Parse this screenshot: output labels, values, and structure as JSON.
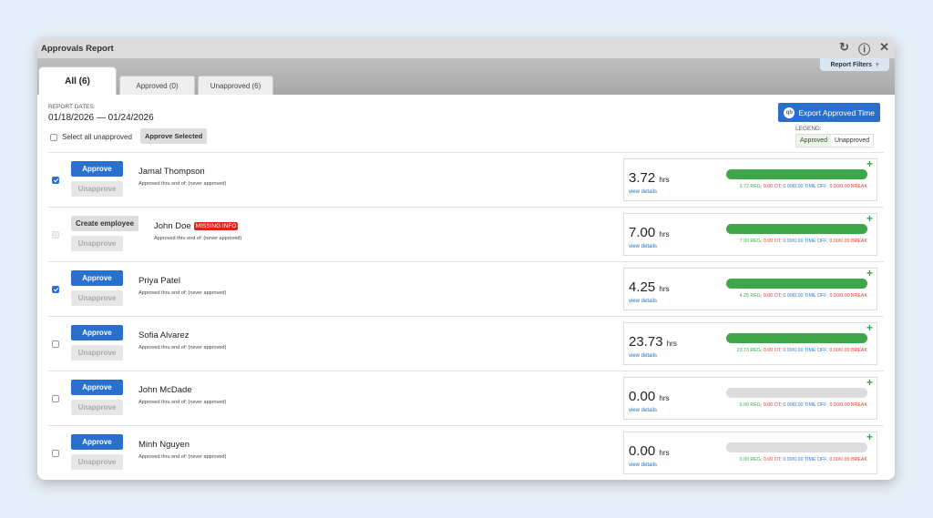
{
  "window": {
    "title": "Approvals Report",
    "icons": [
      "refresh-icon",
      "help-icon",
      "close-icon"
    ]
  },
  "tabs": [
    {
      "label": "All (6)",
      "active": true
    },
    {
      "label": "Approved (0)"
    },
    {
      "label": "Unapproved (6)"
    }
  ],
  "report_filters": "Report Filters",
  "report_dates_label": "REPORT DATES:",
  "report_dates": "01/18/2026 — 01/24/2026",
  "select_all_label": "Select all unapproved",
  "approve_selected": "Approve Selected",
  "export": {
    "icon_text": "qb",
    "label": "Export Approved Time"
  },
  "legend": {
    "label": "LEGEND:",
    "approved": "Approved",
    "unapproved": "Unapproved"
  },
  "colors": {
    "accent": "#2a6fc9",
    "approved": "#3fa64a",
    "missing": "#d9251c"
  },
  "rows": [
    {
      "name": "Jamal Thompson",
      "checked": true,
      "action": "Approve",
      "unapprove": "Unapprove",
      "thru": "Approved thru end of: (never approved)",
      "hours": "3.72",
      "unit": "hrs",
      "view": "view details",
      "fill": 1,
      "reg": "3.72 REG;",
      "ot": "0.00 OT;",
      "timeoff": "0.00/0.00 TIME OFF;",
      "break_a": "0.00/",
      "break_b": "0.00 BREAK"
    },
    {
      "name": "John Doe",
      "badge": "MISSING INFO",
      "checked": false,
      "disabled": true,
      "action": "Create employee",
      "unapprove": "Unapprove",
      "thru": "Approved thru end of: (never approved)",
      "hours": "7.00",
      "unit": "hrs",
      "view": "view details",
      "fill": 1,
      "reg": "7.00 REG;",
      "ot": "0.00 OT;",
      "timeoff": "0.00/0.00 TIME OFF;",
      "break_a": "0.00/",
      "break_b": "0.00 BREAK"
    },
    {
      "name": "Priya Patel",
      "checked": true,
      "action": "Approve",
      "unapprove": "Unapprove",
      "thru": "Approved thru end of: (never approved)",
      "hours": "4.25",
      "unit": "hrs",
      "view": "view details",
      "fill": 1,
      "reg": "4.25 REG;",
      "ot": "0.00 OT;",
      "timeoff": "0.00/0.00 TIME OFF;",
      "break_a": "0.00/",
      "break_b": "0.00 BREAK"
    },
    {
      "name": "Sofia Alvarez",
      "checked": false,
      "action": "Approve",
      "unapprove": "Unapprove",
      "thru": "Approved thru end of: (never approved)",
      "hours": "23.73",
      "unit": "hrs",
      "view": "view details",
      "fill": 1,
      "reg": "23.73 REG;",
      "ot": "0.00 OT;",
      "timeoff": "0.00/0.00 TIME OFF;",
      "break_a": "0.00/",
      "break_b": "0.00 BREAK"
    },
    {
      "name": "John McDade",
      "checked": false,
      "action": "Approve",
      "unapprove": "Unapprove",
      "thru": "Approved thru end of: (never approved)",
      "hours": "0.00",
      "unit": "hrs",
      "view": "view details",
      "fill": 0,
      "reg": "0.00 REG;",
      "ot": "0.00 OT;",
      "timeoff": "0.00/0.00 TIME OFF;",
      "break_a": "0.00/",
      "break_b": "0.00 BREAK"
    },
    {
      "name": "Minh Nguyen",
      "checked": false,
      "action": "Approve",
      "unapprove": "Unapprove",
      "thru": "Approved thru end of: (never approved)",
      "hours": "0.00",
      "unit": "hrs",
      "view": "view details",
      "fill": 0,
      "reg": "0.00 REG;",
      "ot": "0.00 OT;",
      "timeoff": "0.00/0.00 TIME OFF;",
      "break_a": "0.00/",
      "break_b": "0.00 BREAK"
    }
  ]
}
